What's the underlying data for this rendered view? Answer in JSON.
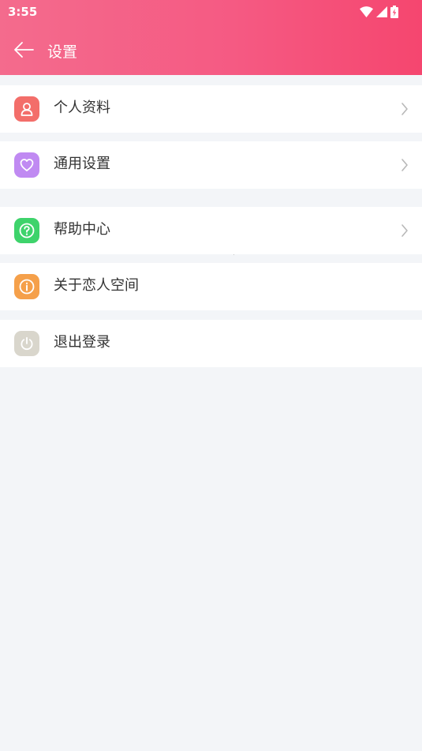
{
  "status_bar": {
    "time": "3:55",
    "icons": [
      "wifi-icon",
      "signal-icon",
      "battery-charging-icon"
    ]
  },
  "toolbar": {
    "title": "设置",
    "back_icon": "arrow-left-icon"
  },
  "menu": {
    "items": [
      {
        "label": "个人资料",
        "icon": "user-icon",
        "color": "#f36e6a",
        "has_chevron": true
      },
      {
        "label": "通用设置",
        "icon": "heart-icon",
        "color": "#c08af2",
        "has_chevron": true
      },
      {
        "label": "帮助中心",
        "icon": "help-icon",
        "color": "#3ed36b",
        "has_chevron": true
      },
      {
        "label": "关于恋人空间",
        "icon": "info-icon",
        "color": "#f5a04a",
        "has_chevron": false
      },
      {
        "label": "退出登录",
        "icon": "power-icon",
        "color": "#d9d6cc",
        "has_chevron": false
      }
    ]
  },
  "colors": {
    "header_gradient_start": "#f46b8d",
    "header_gradient_end": "#f5466f",
    "page_background": "#f3f5f8"
  }
}
